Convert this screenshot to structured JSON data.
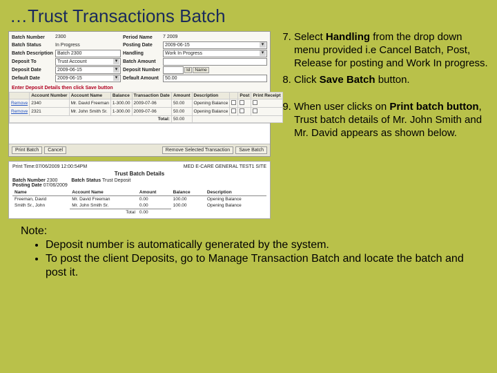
{
  "title": "…Trust Transactions Batch",
  "form": {
    "batchNumberLbl": "Batch Number",
    "batchNumberVal": "2300",
    "periodNameLbl": "Period Name",
    "periodNameVal": "7 2009",
    "batchStatusLbl": "Batch Status",
    "batchStatusVal": "In Progress",
    "postingDateLbl": "Posting Date",
    "postingDateVal": "2009-06-15",
    "batchDescLbl": "Batch Description",
    "batchDescVal": "Batch 2300",
    "handlingLbl": "Handling",
    "handlingVal": "Work In Progress",
    "depositToLbl": "Deposit To",
    "depositToVal": "Trust Account",
    "batchAmountLbl": "Batch Amount",
    "depositDateLbl": "Deposit Date",
    "depositDateVal": "2009-06-15",
    "depositNumberLbl": "Deposit Number",
    "depositNumberVal": "",
    "idLbl": "Id",
    "nameLbl": "Name",
    "defaultDateLbl": "Default Date",
    "defaultDateVal": "2009-06-15",
    "defaultAmountLbl": "Default Amount",
    "defaultAmountVal": "50.00"
  },
  "redline": "Enter Deposit Details then click Save button",
  "table": {
    "headers": [
      "",
      "Account Number",
      "Account Name",
      "Balance",
      "Transaction Date",
      "Amount",
      "Description",
      "",
      "Post",
      "Print Receipt"
    ],
    "rows": [
      [
        "Remove",
        "2340",
        "Mr. David Freeman",
        "1-300.00",
        "2009-07-06",
        "50.00",
        "Opening Balance"
      ],
      [
        "Remove",
        "2321",
        "Mr. John Smith Sr.",
        "1-300.00",
        "2009-07-06",
        "50.00",
        "Opening Balance"
      ]
    ],
    "totalLbl": "Total:",
    "totalVal": "50.00"
  },
  "buttons": {
    "printBatch": "Print Batch",
    "cancel": "Cancel",
    "removeSelected": "Remove Selected Transaction",
    "saveBatch": "Save Batch"
  },
  "detail": {
    "hdr": "Trust Batch Details",
    "site": "MED E-CARE GENERAL TEST1 SITE",
    "printTime": "Print Time:07/06/2009 12:00:54PM",
    "batchNumberLbl": "Batch Number",
    "batchNumberVal": "2300",
    "batchStatusLbl": "Batch Status",
    "batchStatusVal": "Trust Deposit",
    "postingDateLbl": "Posting Date",
    "postingDateVal": "07/06/2009",
    "cols": [
      "Name",
      "Account Name",
      "Amount",
      "Balance",
      "Description"
    ],
    "rows": [
      [
        "Freeman, David",
        "Mr. David Freeman",
        "0.00",
        "100.00",
        "Opening Balance"
      ],
      [
        "Smith Sr., John",
        "Mr. John Smith Sr.",
        "0.00",
        "100.00",
        "Opening Balance"
      ]
    ],
    "totalLbl": "Total",
    "totalVal": "0.00"
  },
  "steps": {
    "s7a": "Select ",
    "s7b": "Handling",
    "s7c": " from the drop down menu provided i.e Cancel Batch, Post, Release for posting and Work In progress.",
    "s8a": "Click ",
    "s8b": "Save Batch",
    "s8c": " button.",
    "s9a": "When user clicks on ",
    "s9b": "Print batch button",
    "s9c": ", Trust batch details of Mr. John Smith and Mr. David appears as shown below."
  },
  "note": {
    "lbl": "Note:",
    "b1": "Deposit number is automatically generated by the system.",
    "b2": "To post the client Deposits, go to Manage Transaction Batch and locate the batch and post it."
  }
}
